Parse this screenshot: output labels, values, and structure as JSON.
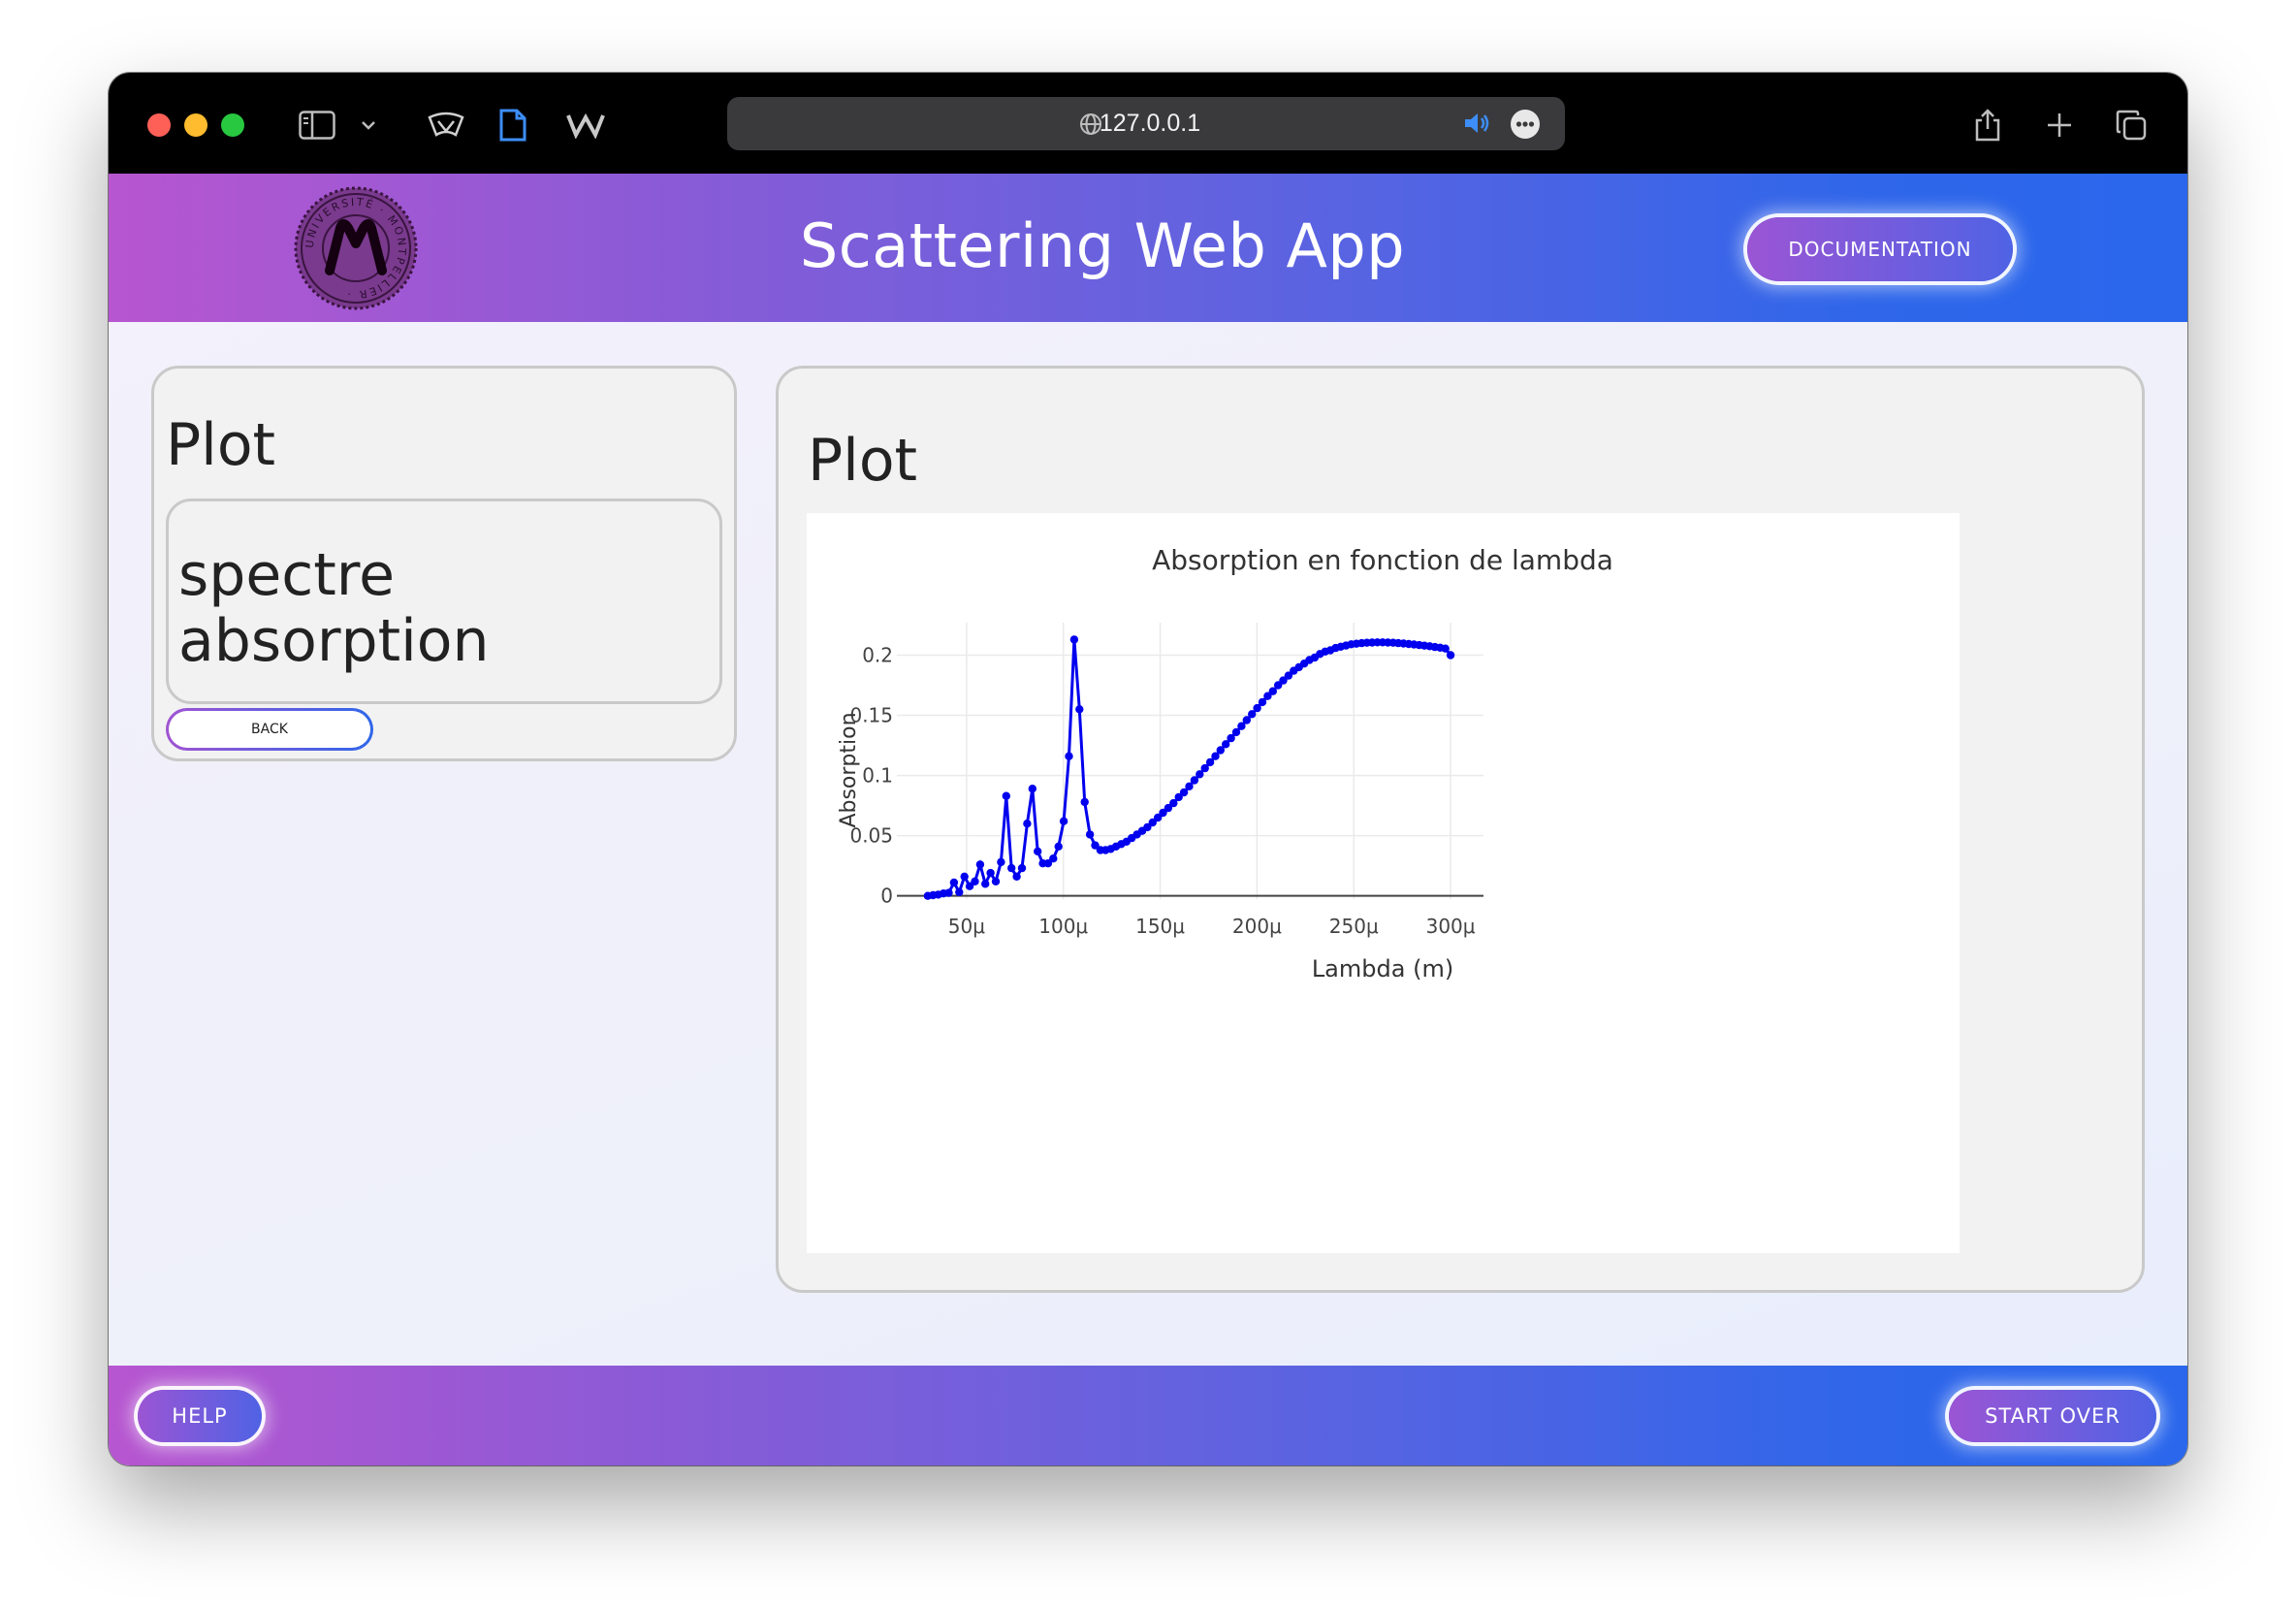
{
  "browser": {
    "url": "127.0.0.1"
  },
  "header": {
    "logo_text": "UNIVERSITÉ MONTPELLIER",
    "title": "Scattering Web App",
    "documentation_label": "DOCUMENTATION"
  },
  "sidebar": {
    "title": "Plot",
    "selected_plot": "spectre absorption",
    "back_label": "BACK"
  },
  "main": {
    "title": "Plot"
  },
  "chart_data": {
    "type": "line",
    "title": "Absorption en fonction de lambda",
    "xlabel": "Lambda (m)",
    "ylabel": "Absorption",
    "xlim": [
      1.4e-05,
      0.000317
    ],
    "ylim": [
      -0.018,
      0.227
    ],
    "x_ticks": [
      5e-05,
      0.0001,
      0.00015,
      0.0002,
      0.00025,
      0.0003
    ],
    "x_tick_labels": [
      "50μ",
      "100μ",
      "150μ",
      "200μ",
      "250μ",
      "300μ"
    ],
    "y_ticks": [
      0,
      0.05,
      0.1,
      0.15,
      0.2
    ],
    "y_tick_labels": [
      "0",
      "0.05",
      "0.1",
      "0.15",
      "0.2"
    ],
    "grid": true,
    "color": "#0000ee",
    "series": [
      {
        "x": [
          3e-05,
          3.27e-05,
          3.54e-05,
          3.81e-05,
          4.08e-05,
          4.35e-05,
          4.62e-05,
          4.89e-05,
          5.16e-05,
          5.43e-05,
          5.7e-05,
          5.97e-05,
          6.24e-05,
          6.51e-05,
          6.78e-05,
          7.05e-05,
          7.32e-05,
          7.59e-05,
          7.86e-05,
          8.13e-05,
          8.4e-05,
          8.67e-05,
          8.94e-05,
          9.21e-05,
          9.48e-05,
          9.75e-05,
          0.0001002,
          0.0001029,
          0.0001056,
          0.0001083,
          0.000111,
          0.0001137,
          0.0001164,
          0.0001191,
          0.0001218,
          0.0001245,
          0.0001272,
          0.0001299,
          0.0001326,
          0.0001353,
          0.000138,
          0.0001407,
          0.0001434,
          0.0001461,
          0.0001488,
          0.0001515,
          0.0001542,
          0.0001569,
          0.0001596,
          0.0001623,
          0.000165,
          0.0001677,
          0.0001704,
          0.0001731,
          0.0001758,
          0.0001785,
          0.0001812,
          0.0001839,
          0.0001866,
          0.0001893,
          0.000192,
          0.0001947,
          0.0001974,
          0.0002001,
          0.0002028,
          0.0002055,
          0.0002082,
          0.0002109,
          0.0002136,
          0.0002163,
          0.000219,
          0.0002217,
          0.0002244,
          0.0002271,
          0.0002298,
          0.0002325,
          0.0002352,
          0.0002379,
          0.0002406,
          0.0002433,
          0.000246,
          0.0002487,
          0.0002514,
          0.0002541,
          0.0002568,
          0.0002595,
          0.0002622,
          0.0002649,
          0.0002676,
          0.0002703,
          0.000273,
          0.0002757,
          0.0002784,
          0.0002811,
          0.0002838,
          0.0002865,
          0.0002892,
          0.0002919,
          0.0002946,
          0.0002973,
          0.0003
        ],
        "y": [
          0,
          0.0005,
          0.001,
          0.002,
          0.0025,
          0.011,
          0.003,
          0.016,
          0.008,
          0.012,
          0.026,
          0.01,
          0.019,
          0.012,
          0.028,
          0.083,
          0.023,
          0.016,
          0.023,
          0.06,
          0.089,
          0.037,
          0.027,
          0.027,
          0.031,
          0.041,
          0.062,
          0.116,
          0.213,
          0.155,
          0.078,
          0.051,
          0.042,
          0.038,
          0.038,
          0.039,
          0.041,
          0.043,
          0.045,
          0.048,
          0.051,
          0.054,
          0.057,
          0.061,
          0.065,
          0.069,
          0.073,
          0.077,
          0.082,
          0.086,
          0.091,
          0.096,
          0.101,
          0.106,
          0.111,
          0.116,
          0.121,
          0.126,
          0.131,
          0.136,
          0.141,
          0.146,
          0.151,
          0.156,
          0.161,
          0.166,
          0.17,
          0.175,
          0.179,
          0.183,
          0.187,
          0.19,
          0.193,
          0.196,
          0.198,
          0.201,
          0.203,
          0.204,
          0.206,
          0.207,
          0.208,
          0.209,
          0.2095,
          0.21,
          0.2103,
          0.2105,
          0.2106,
          0.2106,
          0.2105,
          0.2103,
          0.21,
          0.2097,
          0.2093,
          0.2089,
          0.2084,
          0.2079,
          0.2074,
          0.2068,
          0.2062,
          0.2055,
          0.2
        ]
      }
    ]
  },
  "footer": {
    "help_label": "HELP",
    "start_over_label": "START OVER"
  }
}
